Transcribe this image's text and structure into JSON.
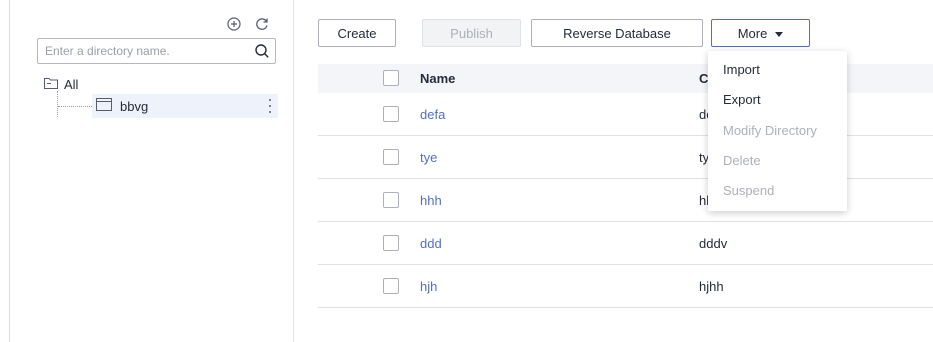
{
  "sidebar": {
    "search_placeholder": "Enter a directory name.",
    "tree": {
      "root_label": "All",
      "children": [
        {
          "label": "bbvg"
        }
      ]
    }
  },
  "toolbar": {
    "create_label": "Create",
    "publish_label": "Publish",
    "reverse_db_label": "Reverse Database",
    "more_label": "More"
  },
  "table": {
    "columns": [
      "Name",
      "C"
    ],
    "rows": [
      {
        "name": "defa",
        "col2": "de"
      },
      {
        "name": "tye",
        "col2": "ty"
      },
      {
        "name": "hhh",
        "col2": "hh"
      },
      {
        "name": "ddd",
        "col2": "dddv"
      },
      {
        "name": "hjh",
        "col2": "hjhh"
      }
    ]
  },
  "more_menu": {
    "items": [
      {
        "label": "Import",
        "enabled": true
      },
      {
        "label": "Export",
        "enabled": true
      },
      {
        "label": "Modify Directory",
        "enabled": false
      },
      {
        "label": "Delete",
        "enabled": false
      },
      {
        "label": "Suspend",
        "enabled": false
      }
    ]
  },
  "colors": {
    "link": "#526ecc",
    "border": "#adb0b8",
    "disabled_text": "#adb0b8",
    "header_bg": "#f3f5f9",
    "selected_node_bg": "#eef3fb"
  }
}
